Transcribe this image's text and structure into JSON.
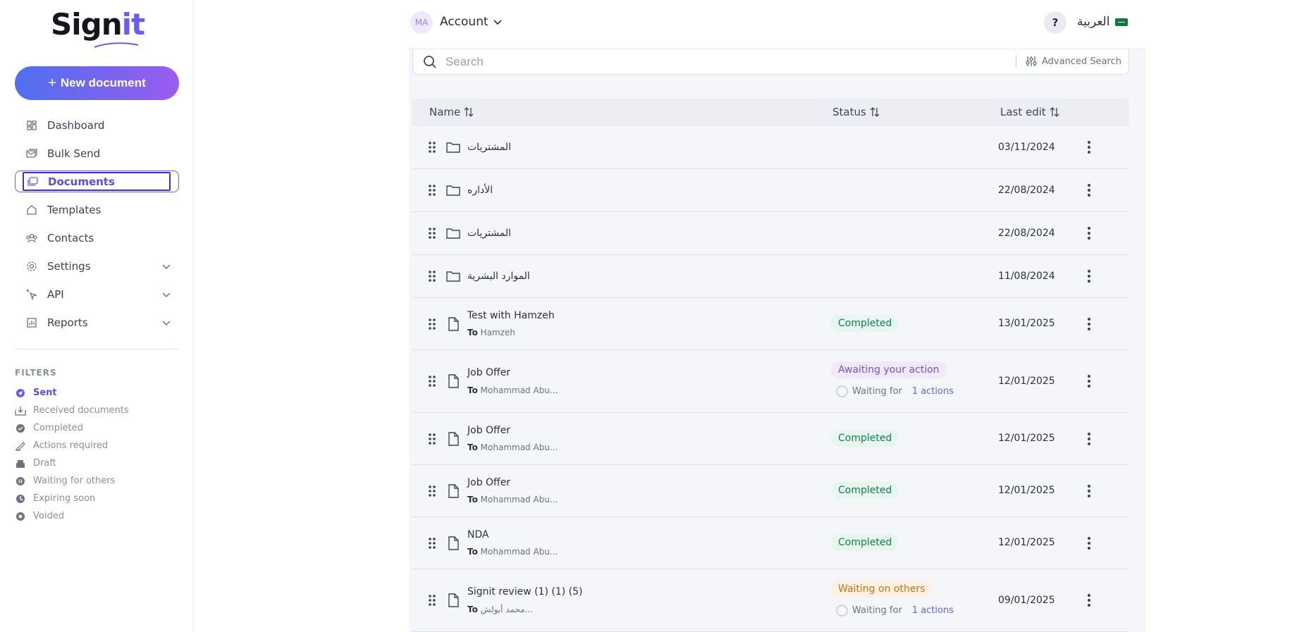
{
  "brand": {
    "logo_main": "Sign",
    "logo_accent": "it"
  },
  "sidebar": {
    "new_document": "New document",
    "nav": [
      {
        "label": "Dashboard",
        "icon": "dashboard-icon"
      },
      {
        "label": "Bulk Send",
        "icon": "bulk-send-icon"
      },
      {
        "label": "Documents",
        "icon": "documents-icon",
        "active": true
      },
      {
        "label": "Templates",
        "icon": "templates-icon"
      },
      {
        "label": "Contacts",
        "icon": "contacts-icon"
      },
      {
        "label": "Settings",
        "icon": "gear-icon",
        "expandable": true
      },
      {
        "label": "API",
        "icon": "api-icon",
        "expandable": true
      },
      {
        "label": "Reports",
        "icon": "reports-icon",
        "expandable": true
      }
    ],
    "filters_title": "FILTERS",
    "filters": [
      {
        "label": "Sent",
        "active": true
      },
      {
        "label": "Received documents"
      },
      {
        "label": "Completed"
      },
      {
        "label": "Actions required"
      },
      {
        "label": "Draft"
      },
      {
        "label": "Waiting for others"
      },
      {
        "label": "Expiring soon"
      },
      {
        "label": "Voided"
      }
    ]
  },
  "header": {
    "avatar_initials": "MA",
    "account_label": "Account",
    "help_label": "?",
    "language_label": "العربية"
  },
  "search": {
    "placeholder": "Search",
    "value": "",
    "advanced_label": "Advanced Search"
  },
  "table": {
    "columns": [
      "Name",
      "Status",
      "Last edit"
    ],
    "to_prefix": "To",
    "waiting_for_label": "Waiting for",
    "rows": [
      {
        "type": "folder",
        "name": "المشتريات",
        "date": "03/11/2024"
      },
      {
        "type": "folder",
        "name": "الأداره",
        "date": "22/08/2024"
      },
      {
        "type": "folder",
        "name": "المشتريات",
        "date": "22/08/2024"
      },
      {
        "type": "folder",
        "name": "الموارد البشرية",
        "date": "11/08/2024"
      },
      {
        "type": "doc",
        "name": "Test with Hamzeh",
        "to": "Hamzeh",
        "status": "Completed",
        "date": "13/01/2025"
      },
      {
        "type": "doc",
        "name": "Job Offer",
        "to": "Mohammad Abu...",
        "status": "Awaiting your action",
        "waiting": "1 actions",
        "date": "12/01/2025"
      },
      {
        "type": "doc",
        "name": "Job Offer",
        "to": "Mohammad Abu...",
        "status": "Completed",
        "date": "12/01/2025"
      },
      {
        "type": "doc",
        "name": "Job Offer",
        "to": "Mohammad Abu...",
        "status": "Completed",
        "date": "12/01/2025"
      },
      {
        "type": "doc",
        "name": "NDA",
        "to": "Mohammad Abu...",
        "status": "Completed",
        "date": "12/01/2025"
      },
      {
        "type": "doc",
        "name": "Signit review (1) (1) (5)",
        "to": "محمد أبولش...",
        "status": "Waiting on others",
        "waiting": "1 actions",
        "date": "09/01/2025"
      }
    ]
  },
  "colors": {
    "accent": "#6b5cf6",
    "completed": "#13804a",
    "awaiting": "#7a4fd6",
    "waiting": "#c07418"
  }
}
